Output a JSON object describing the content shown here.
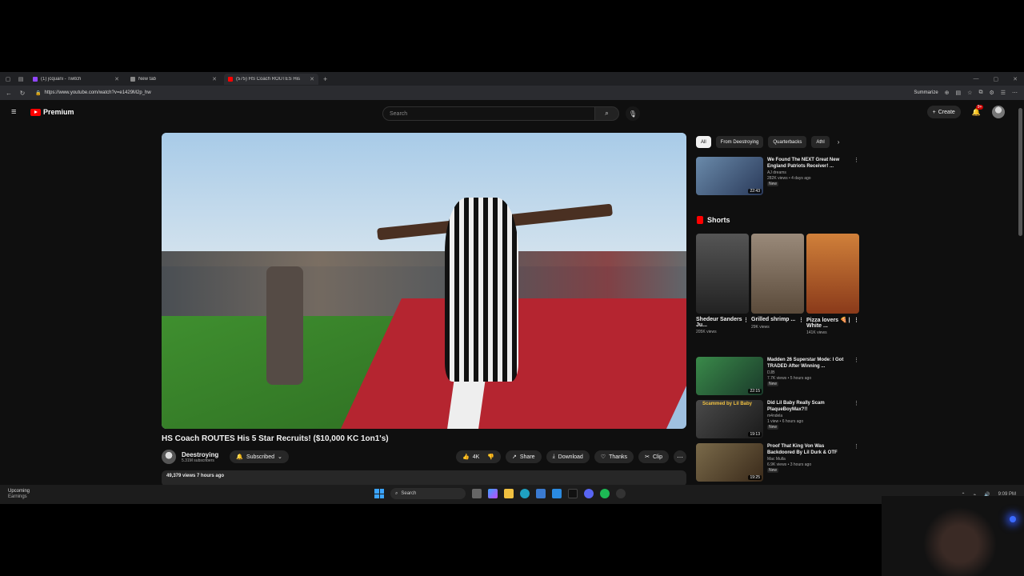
{
  "browser": {
    "tabs": [
      {
        "title": "(1) jcquani - Twitch",
        "favicon_color": "#9146ff"
      },
      {
        "title": "New tab",
        "favicon_color": "#888888"
      },
      {
        "title": "(575) HS Coach ROUTES His",
        "favicon_color": "#ff0000"
      }
    ],
    "url": "https://www.youtube.com/watch?v=e1429M2p_hw",
    "summarize_label": "Summarize"
  },
  "youtube": {
    "logo_text": "Premium",
    "search_placeholder": "Search",
    "create_label": "Create",
    "notification_count": "9+"
  },
  "video": {
    "title": "HS Coach ROUTES His 5 Star Recruits! ($10,000 KC 1on1's)",
    "channel": "Deestroying",
    "subscribers": "5.31M subscribers",
    "subscribed_label": "Subscribed",
    "likes": "4K",
    "share_label": "Share",
    "download_label": "Download",
    "thanks_label": "Thanks",
    "clip_label": "Clip",
    "views_time": "49,379 views  7 hours ago"
  },
  "sidebar": {
    "chips": [
      "All",
      "From Deestroying",
      "Quarterbacks",
      "Athl"
    ],
    "recommendations_top": [
      {
        "title": "We Found The NEXT Great New England Patriots Receiver! ...",
        "channel": "AJ dreams",
        "stats": "282K views • 4 days ago",
        "duration": "22:43",
        "badge": "New",
        "thumb_color": "#4a6a8a"
      }
    ],
    "shorts_label": "Shorts",
    "shorts": [
      {
        "title": "Shedeur Sanders Ju...",
        "views": "205K views",
        "thumb_color": "#4a4a4a"
      },
      {
        "title": "Grilled shrimp ...",
        "views": "29K views",
        "thumb_color": "#8a7a6a"
      },
      {
        "title": "Pizza lovers 🍕 | White ...",
        "views": "141K views",
        "thumb_color": "#b5652a"
      }
    ],
    "recommendations": [
      {
        "title": "Madden 26 Superstar Mode: I Got TRADED After Winning ...",
        "channel": "DJB",
        "stats": "7.7K views • 5 hours ago",
        "duration": "22:15",
        "badge": "New",
        "thumb_color": "#2e6a3a"
      },
      {
        "title": "Did Lil Baby Really Scam PlaqueBoyMax?!!",
        "channel": "m4ndela",
        "stats": "1 view • 6 hours ago",
        "duration": "19:13",
        "badge": "New",
        "thumb_color": "#3a3a3a",
        "thumb_caption": "Scammed by Lil Baby"
      },
      {
        "title": "Proof That King Von Was Backdoored By Lil Durk & OTF",
        "channel": "Mac Mulla",
        "stats": "6.9K views • 3 hours ago",
        "duration": "19:25",
        "badge": "New",
        "thumb_color": "#5a4a3a"
      }
    ]
  },
  "taskbar": {
    "weather_title": "Upcoming",
    "weather_sub": "Earnings",
    "search_label": "Search",
    "time": "9:09 PM"
  }
}
